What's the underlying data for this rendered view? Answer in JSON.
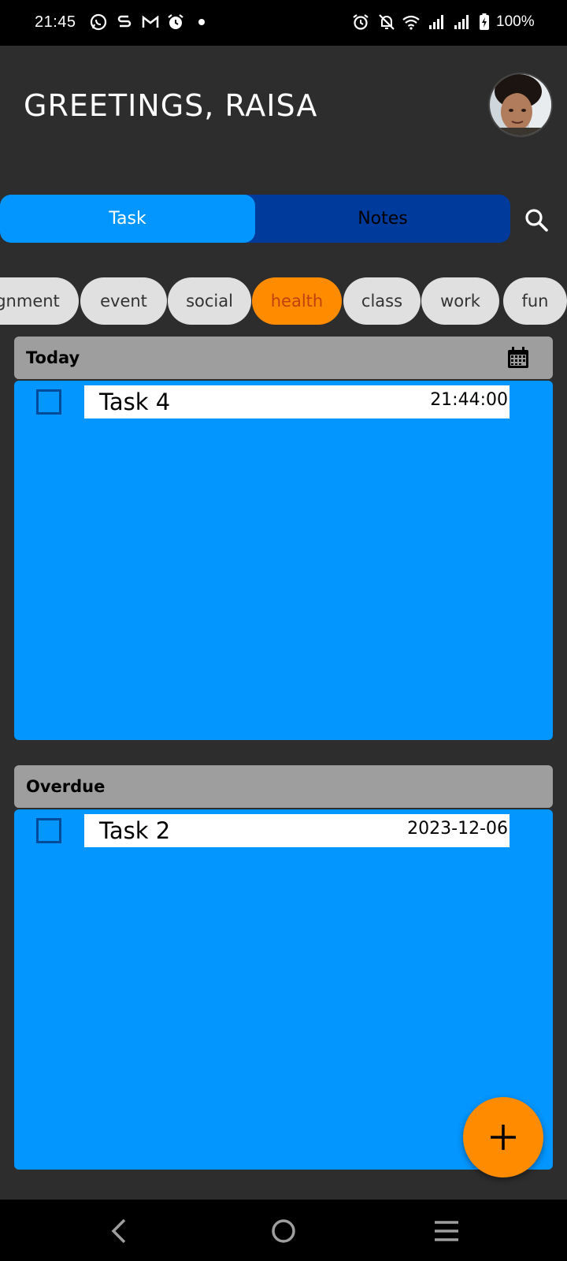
{
  "status_bar": {
    "time": "21:45",
    "battery": "100%",
    "icons_left": [
      "whatsapp-icon",
      "s-app-icon",
      "gmail-icon",
      "alarm-icon",
      "dot-icon"
    ],
    "icons_right": [
      "alarm-icon",
      "bell-off-icon",
      "wifi-icon",
      "signal-icon",
      "signal-icon",
      "battery-charging-icon"
    ]
  },
  "header": {
    "greeting": "GREETINGS, RAISA",
    "avatar_icon": "avatar-photo"
  },
  "tabs": {
    "task_label": "Task",
    "notes_label": "Notes",
    "active": "Task",
    "search_icon": "search-icon"
  },
  "categories": {
    "items": [
      "gnment",
      "event",
      "social",
      "health",
      "class",
      "work",
      "fun"
    ],
    "active": "health"
  },
  "sections": {
    "today": {
      "title": "Today",
      "icon": "calendar-icon",
      "tasks": [
        {
          "name": "Task 4",
          "time": "21:44:00",
          "checked": false
        }
      ]
    },
    "overdue": {
      "title": "Overdue",
      "tasks": [
        {
          "name": "Task 2",
          "time": "2023-12-06",
          "checked": false
        }
      ]
    }
  },
  "fab": {
    "icon": "plus-icon"
  },
  "nav": {
    "icons": [
      "back-icon",
      "home-icon",
      "menu-icon"
    ]
  },
  "colors": {
    "background": "#2d2d2d",
    "primary_blue": "#0396fe",
    "dark_blue": "#003a9b",
    "accent_orange": "#ff8c00",
    "section_header_gray": "#9e9e9e",
    "chip_gray": "#e0e0e0"
  }
}
